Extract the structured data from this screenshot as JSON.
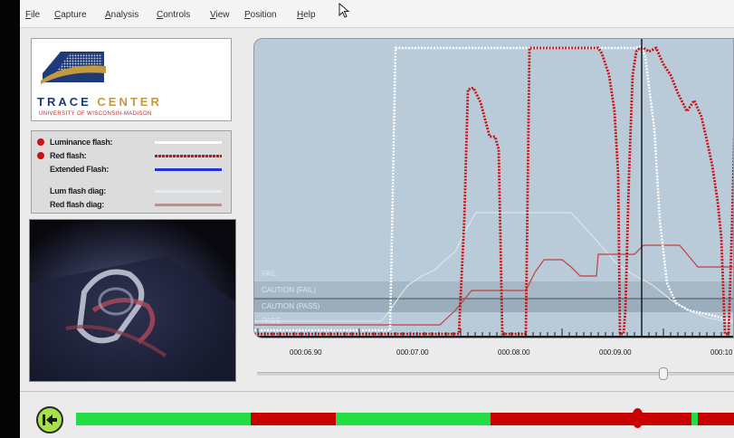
{
  "menubar": {
    "items": [
      "File",
      "Capture",
      "Analysis",
      "Controls",
      "View",
      "Position",
      "Help"
    ]
  },
  "logo": {
    "name_part1": "TRACE",
    "name_part2": "CENTER",
    "subtitle": "UNIVERSITY OF WISCONSIN-MADISON"
  },
  "legend": {
    "items": [
      {
        "label": "Luminance flash:",
        "swatch": "#ffffff",
        "style": "solid"
      },
      {
        "label": "Red flash:",
        "swatch": "#cc1111",
        "style": "dotted"
      },
      {
        "label": "Extended Flash:",
        "swatch": "#2233dd",
        "style": "solid"
      },
      {
        "label": "Lum flash diag:",
        "swatch": "#e4ecf2",
        "style": "solid"
      },
      {
        "label": "Red flash diag:",
        "swatch": "#c98a8a",
        "style": "solid"
      }
    ]
  },
  "chart": {
    "zones": [
      "FAIL",
      "CAUTION (FAIL)",
      "CAUTION (PASS)",
      "PASS"
    ],
    "ticks": [
      "000:06.90",
      "000:07.00",
      "000:08.00",
      "000:09.00",
      "000:10"
    ]
  },
  "colors": {
    "accent_red": "#c90000",
    "accent_green": "#22dd44",
    "chart_bg": "#b9cad8",
    "rewind": "#a8e04a"
  },
  "icons": {
    "rewind": "skip-to-start-icon"
  },
  "timeline": {
    "segments": [
      {
        "state": "pass",
        "to": 0.265
      },
      {
        "state": "fail",
        "to": 0.395
      },
      {
        "state": "pass",
        "to": 0.63
      },
      {
        "state": "fail",
        "to": 0.935
      },
      {
        "state": "pass",
        "to": 0.945
      },
      {
        "state": "fail",
        "to": 1.0
      }
    ]
  }
}
